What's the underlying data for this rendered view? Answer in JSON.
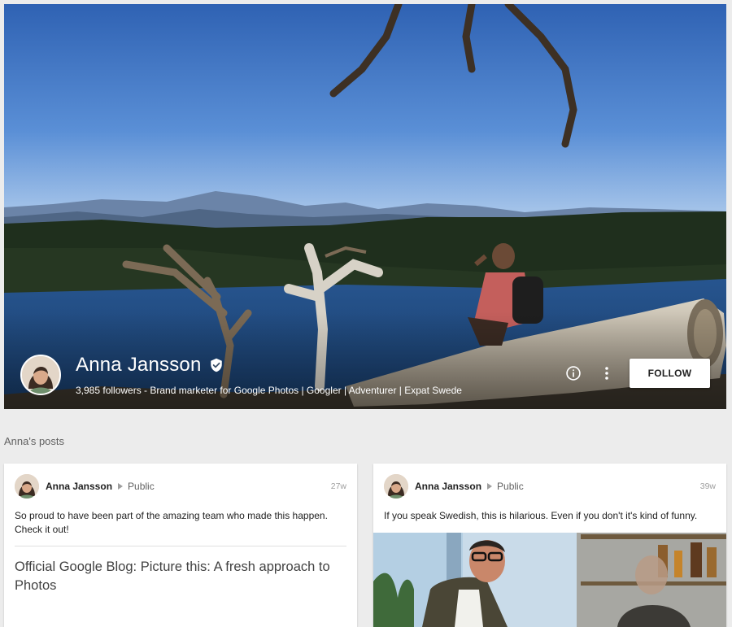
{
  "profile": {
    "name": "Anna Jansson",
    "tagline": "3,985 followers - Brand marketer for Google Photos | Googler | Adventurer | Expat Swede",
    "follow_label": "FOLLOW",
    "verified": true
  },
  "posts_section": {
    "title": "Anna's posts"
  },
  "posts": [
    {
      "author": "Anna Jansson",
      "visibility": "Public",
      "time": "27w",
      "text": "So proud to have been part of the amazing team who made this happen. Check it out!",
      "link_title": "Official Google Blog: Picture this: A fresh approach to Photos"
    },
    {
      "author": "Anna Jansson",
      "visibility": "Public",
      "time": "39w",
      "text": "If you speak Swedish, this is hilarious. Even if you don't it's kind of funny.",
      "media_type": "video"
    }
  ],
  "icons": {
    "verified": "verified-check-icon",
    "info": "info-icon",
    "more": "more-vert-icon",
    "share_arrow": "arrow-right-icon"
  },
  "colors": {
    "background": "#ececec",
    "card": "#ffffff",
    "follow_button": "#ffffff",
    "name_text": "#ffffff"
  }
}
